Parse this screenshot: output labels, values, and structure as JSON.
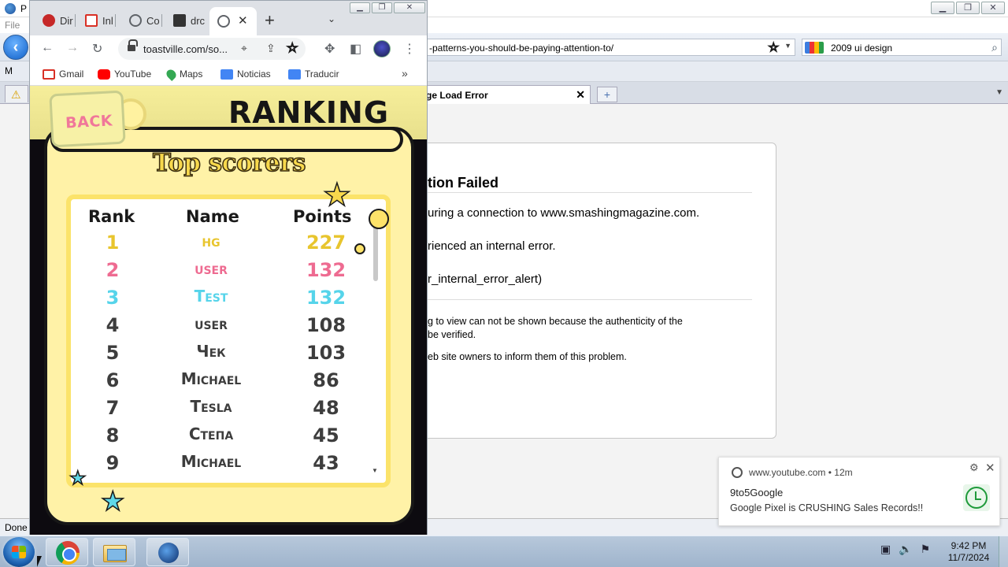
{
  "firefox": {
    "title_char": "P",
    "menu": "File",
    "bookmark_char": "M",
    "url": "-patterns-you-should-be-paying-attention-to/",
    "search_value": "2009 ui design",
    "active_tab_label": "ge Load Error",
    "error": {
      "heading": "tion Failed",
      "line1": "uring a connection to www.smashingmagazine.com.",
      "line2": "rienced an internal error.",
      "line3": "r_internal_error_alert)",
      "detail1a": "g to view can not be shown because the authenticity of the",
      "detail1b": "be verified.",
      "detail2": "eb site owners to inform them of this problem."
    },
    "status": "Done"
  },
  "chrome": {
    "tabs": [
      {
        "label": "Dir",
        "icon": "red-app-icon",
        "color": "#c62828"
      },
      {
        "label": "Inl",
        "icon": "gmail-icon",
        "color": "#d93025"
      },
      {
        "label": "Co",
        "icon": "globe-icon",
        "color": "#5f6368"
      },
      {
        "label": "drc",
        "icon": "terminal-icon",
        "color": "#333333"
      }
    ],
    "active_tab_close": "✕",
    "url": "toastville.com/so...",
    "bookmarks": [
      {
        "label": "Gmail",
        "icon": "gmail-icon",
        "color": "#d93025"
      },
      {
        "label": "YouTube",
        "icon": "youtube-icon",
        "color": "#ff0000"
      },
      {
        "label": "Maps",
        "icon": "maps-pin-icon",
        "color": "#34a853"
      },
      {
        "label": "Noticias",
        "icon": "news-icon",
        "color": "#4285f4"
      },
      {
        "label": "Traducir",
        "icon": "translate-icon",
        "color": "#4285f4"
      }
    ]
  },
  "game": {
    "back_label": "BACK",
    "title": "RANKING",
    "subtitle": "Top scorers",
    "headers": {
      "rank": "Rank",
      "name": "Name",
      "points": "Points"
    },
    "rows": [
      {
        "rank": "1",
        "name": "hg",
        "points": "227",
        "color": "#e8c52e"
      },
      {
        "rank": "2",
        "name": "user",
        "points": "132",
        "color": "#ee6b91"
      },
      {
        "rank": "3",
        "name": "Test",
        "points": "132",
        "color": "#56d4ea"
      },
      {
        "rank": "4",
        "name": "user",
        "points": "108",
        "color": "#3d3d3d"
      },
      {
        "rank": "5",
        "name": "Чек",
        "points": "103",
        "color": "#3d3d3d"
      },
      {
        "rank": "6",
        "name": "Michael",
        "points": "86",
        "color": "#3d3d3d"
      },
      {
        "rank": "7",
        "name": "Tesla",
        "points": "48",
        "color": "#3d3d3d"
      },
      {
        "rank": "8",
        "name": "Степа",
        "points": "45",
        "color": "#3d3d3d"
      },
      {
        "rank": "9",
        "name": "Michael",
        "points": "43",
        "color": "#3d3d3d"
      }
    ]
  },
  "notification": {
    "source": "www.youtube.com",
    "age": "12m",
    "title": "9to5Google",
    "message": "Google Pixel is CRUSHING Sales Records!!"
  },
  "taskbar": {
    "time": "9:42 PM",
    "date": "11/7/2024"
  }
}
